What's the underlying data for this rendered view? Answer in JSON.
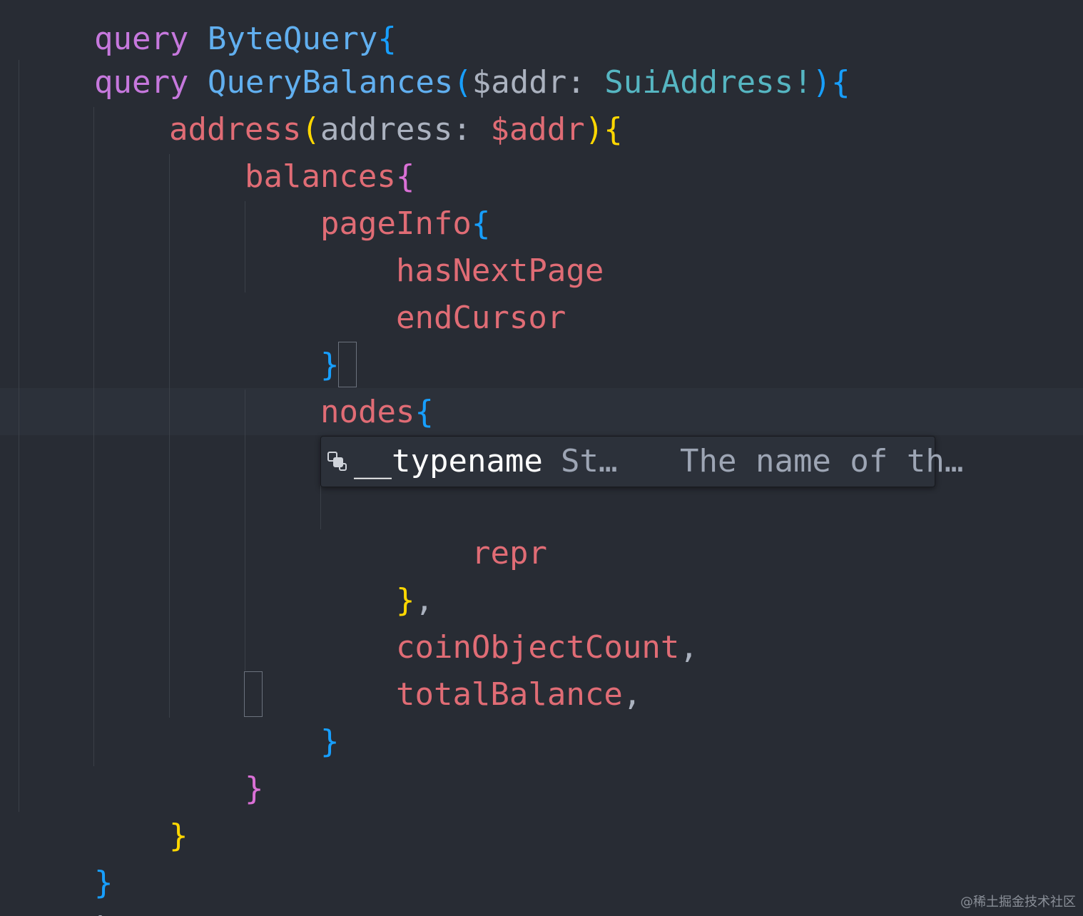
{
  "colors": {
    "background": "#282c34",
    "keyword": "#c678dd",
    "function": "#61afef",
    "type": "#56b6c2",
    "field": "#e06c75",
    "bracket_level1": "#ffd700",
    "bracket_level2": "#da70d6",
    "bracket_level3": "#179fff"
  },
  "code": {
    "line1": {
      "keyword": "query",
      "name": "QueryBalances",
      "open_paren": "(",
      "var": "$addr",
      "colon": ": ",
      "type": "SuiAddress!",
      "close_paren": ")",
      "brace": "{"
    },
    "line2": {
      "field": "address",
      "open_paren": "(",
      "arg": "address",
      "colon": ": ",
      "var": "$addr",
      "close_paren": ")",
      "brace": "{"
    },
    "line3": {
      "field": "balances",
      "brace": "{"
    },
    "line4": {
      "field": "pageInfo",
      "brace": "{"
    },
    "line5": {
      "field": "hasNextPage"
    },
    "line6": {
      "field": "endCursor"
    },
    "line7": {
      "brace": "}"
    },
    "line8": {
      "field": "nodes",
      "brace": "{"
    },
    "line10": {
      "field": "repr"
    },
    "line11": {
      "brace": "}",
      "comma": ","
    },
    "line12": {
      "field": "coinObjectCount",
      "comma": ","
    },
    "line13": {
      "field": "totalBalance",
      "comma": ","
    },
    "line14": {
      "brace": "}"
    },
    "line15": {
      "brace": "}"
    },
    "line16": {
      "brace": "}"
    },
    "line17": {
      "brace": "}"
    },
    "line18": {
      "backtick": "`",
      "paren": ")",
      "comma": ","
    }
  },
  "suggestion": {
    "icon": "field-icon",
    "label": "__typename",
    "type": "St…",
    "doc": "The name of th…"
  },
  "watermark": "@稀土掘金技术社区"
}
